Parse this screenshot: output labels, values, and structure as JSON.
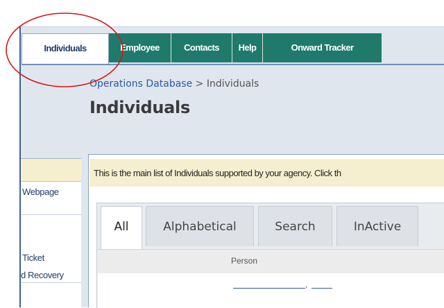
{
  "nav": {
    "tabs": [
      {
        "label": "Individuals",
        "active": true
      },
      {
        "label": "Employee",
        "active": false
      },
      {
        "label": "Contacts",
        "active": false
      },
      {
        "label": "Help",
        "active": false
      },
      {
        "label": "Onward Tracker",
        "active": false
      }
    ]
  },
  "breadcrumb": {
    "root": "Operations Database",
    "separator": ">",
    "current": "Individuals"
  },
  "page_title": "Individuals",
  "sidebar": {
    "items": [
      "Webpage",
      "Ticket",
      "d Recovery"
    ]
  },
  "intro": {
    "text": "This is the main list of Individuals supported by your agency. Click th"
  },
  "filter_tabs": [
    {
      "label": "All",
      "active": true
    },
    {
      "label": "Alphabetical",
      "active": false
    },
    {
      "label": "Search",
      "active": false
    },
    {
      "label": "InActive",
      "active": false
    }
  ],
  "table": {
    "columns": [
      "Person"
    ],
    "name_separator": ","
  },
  "colors": {
    "nav_tab": "#1f7a6b",
    "nav_tab_active_text": "#1f3d6b",
    "link": "#2b5aa8",
    "intro_bar": "#f6efcf",
    "annotation": "#dd1111"
  }
}
